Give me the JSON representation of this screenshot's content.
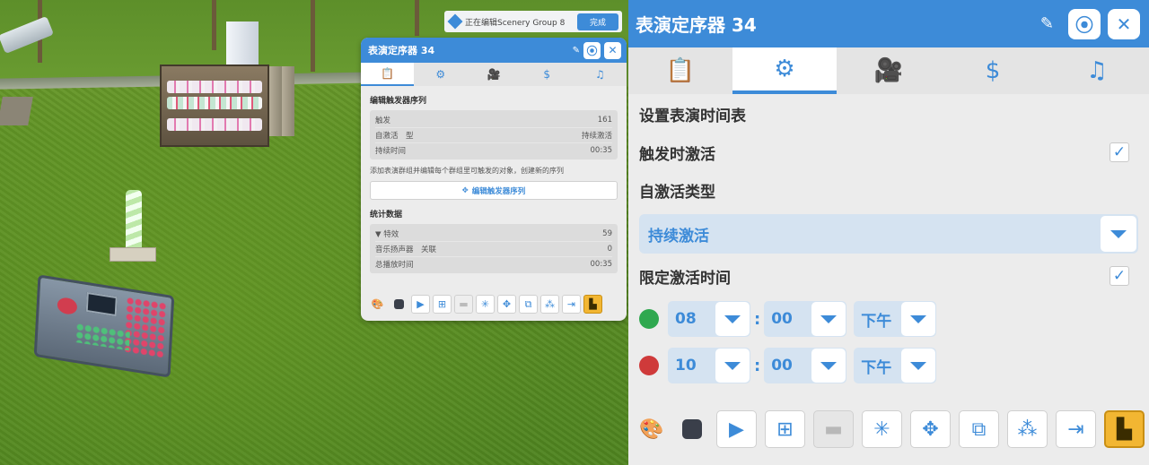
{
  "scene": {
    "banner_text": "正在编辑Scenery Group 8",
    "banner_button": "完成"
  },
  "mini_panel": {
    "title": "表演定序器 34",
    "tabs": [
      "📋",
      "⚙",
      "🎥",
      "$",
      "♫"
    ],
    "trigger_section": "编辑触发器序列",
    "rows": [
      {
        "label": "触发",
        "value": "161"
      },
      {
        "label": "自激活　型",
        "value": "持续激活"
      },
      {
        "label": "持续时间",
        "value": "00:35"
      }
    ],
    "note": "添加表演群组并编辑每个群组里可触发的对象，创建新的序列",
    "edit_button": "编辑触发器序列",
    "stats_section": "统计数据",
    "stats": [
      {
        "label": "▼ 特效",
        "value": "59"
      },
      {
        "label": "音乐扬声器　关联",
        "value": "0"
      },
      {
        "label": "总播放时间",
        "value": "00:35"
      }
    ]
  },
  "panel": {
    "title": "表演定序器 34",
    "schedule_heading": "设置表演时间表",
    "activate_on_trigger": {
      "label": "触发时激活",
      "checked": true
    },
    "auto_type_label": "自激活类型",
    "auto_type_value": "持续激活",
    "limit_time": {
      "label": "限定激活时间",
      "checked": true
    },
    "start_time": {
      "hour": "08",
      "minute": "00",
      "period": "下午",
      "color": "#2fa84f"
    },
    "end_time": {
      "hour": "10",
      "minute": "00",
      "period": "下午",
      "color": "#cf3a3a"
    },
    "colon": ":",
    "check_glyph": "✓"
  },
  "colors": {
    "accent": "#3d8bd8",
    "panel_bg": "#ececec",
    "toolbar_gold": "#f2b632"
  },
  "icons": {
    "tabs": [
      "clipboard-icon",
      "gear-icon",
      "camera-icon",
      "dollar-icon",
      "music-icon"
    ],
    "toolbar": [
      "palette-icon",
      "stop-icon",
      "play-icon",
      "hierarchy-icon",
      "camera-icon",
      "sparkle-icon",
      "move-icon",
      "copy-icon",
      "scatter-icon",
      "exit-icon",
      "bulldozer-icon"
    ]
  }
}
